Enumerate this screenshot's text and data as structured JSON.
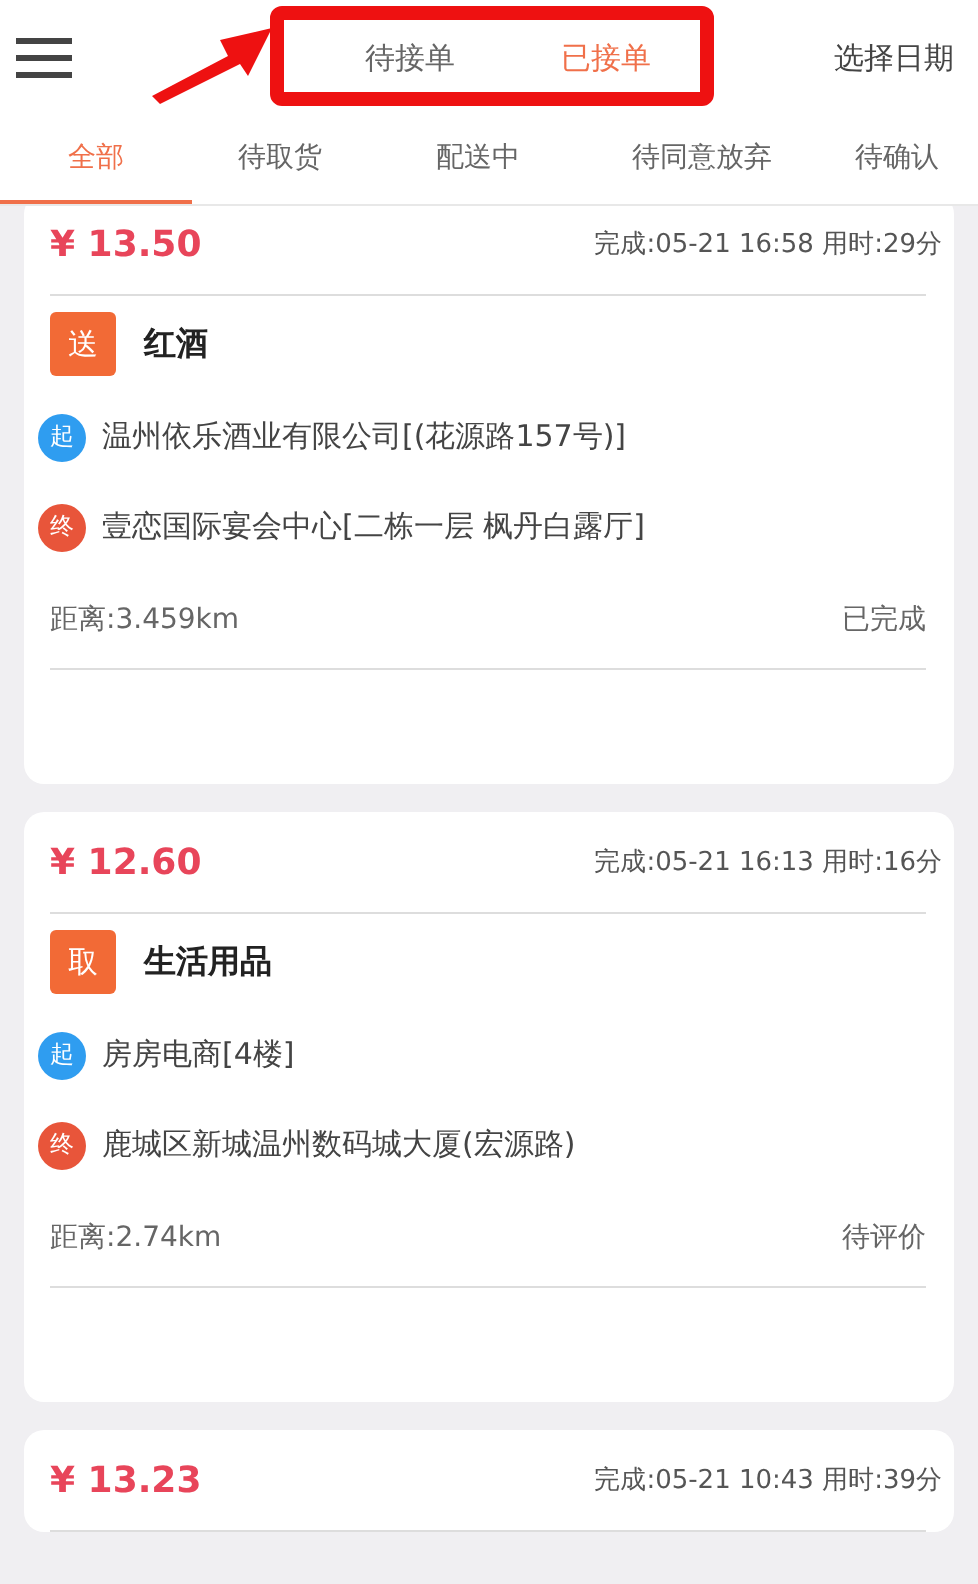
{
  "header": {
    "segments": [
      {
        "label": "待接单",
        "selected": false
      },
      {
        "label": "已接单",
        "selected": true
      }
    ],
    "date_button": "选择日期"
  },
  "tabs": [
    {
      "label": "全部",
      "selected": true
    },
    {
      "label": "待取货",
      "selected": false
    },
    {
      "label": "配送中",
      "selected": false
    },
    {
      "label": "待同意放弃",
      "selected": false
    },
    {
      "label": "待确认",
      "selected": false
    }
  ],
  "orders": [
    {
      "price": "¥ 13.50",
      "completed": "完成:05-21 16:58 用时:29分",
      "type": "送",
      "item": "红酒",
      "start_badge": "起",
      "start": "温州依乐酒业有限公司[(花源路157号)]",
      "end_badge": "终",
      "end": "壹恋国际宴会中心[二栋一层 枫丹白露厅]",
      "distance": "距离:3.459km",
      "status": "已完成"
    },
    {
      "price": "¥ 12.60",
      "completed": "完成:05-21 16:13 用时:16分",
      "type": "取",
      "item": "生活用品",
      "start_badge": "起",
      "start": "房房电商[4楼]",
      "end_badge": "终",
      "end": "鹿城区新城温州数码城大厦(宏源路)",
      "distance": "距离:2.74km",
      "status": "待评价"
    },
    {
      "price": "¥ 13.23",
      "completed": "完成:05-21 10:43 用时:39分"
    }
  ]
}
